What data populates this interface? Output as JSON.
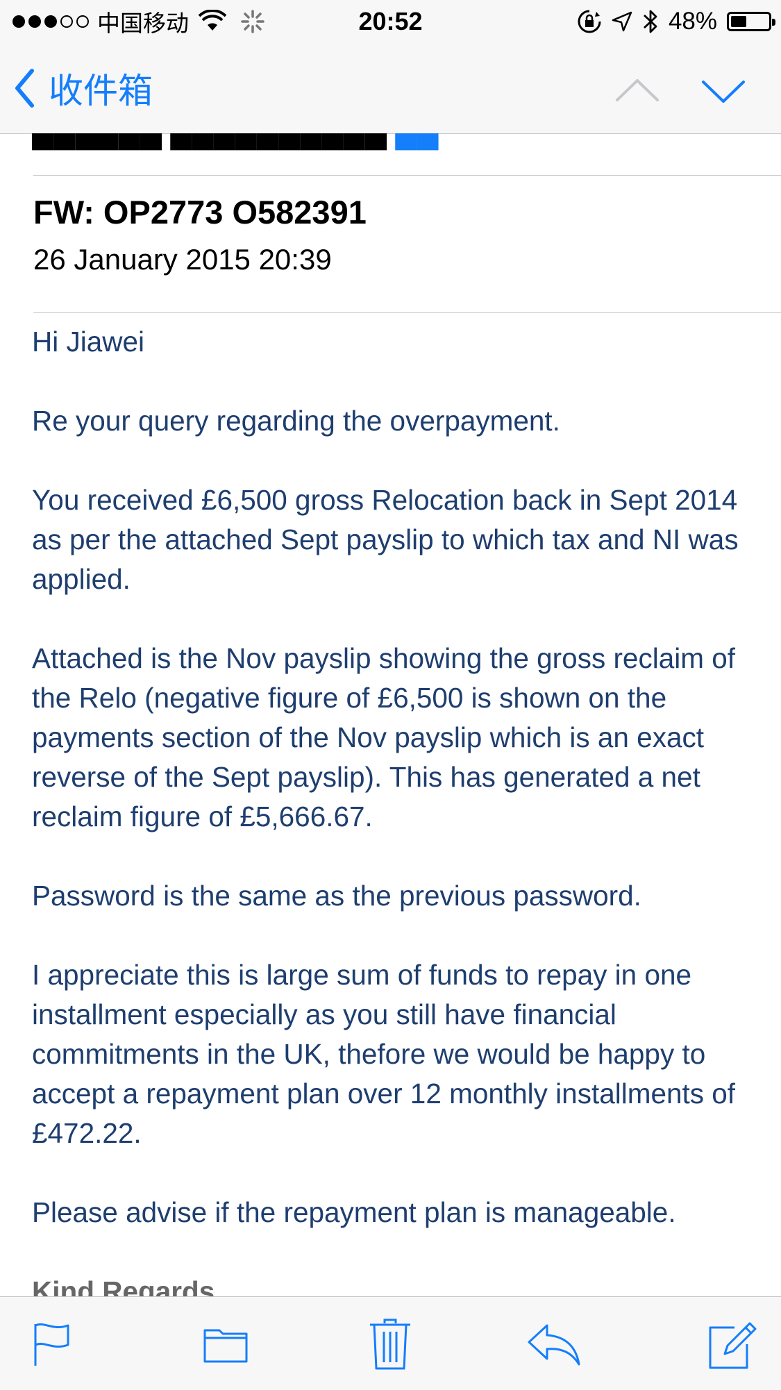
{
  "status_bar": {
    "carrier": "中国移动",
    "time": "20:52",
    "battery_percent": "48%",
    "battery_level": 0.48,
    "icons": [
      "signal-dots-icon",
      "wifi-icon",
      "activity-spinner-icon",
      "orientation-lock-icon",
      "location-arrow-icon",
      "bluetooth-icon",
      "battery-icon"
    ]
  },
  "nav": {
    "back_label": "收件箱",
    "prev_icon": "chevron-up-icon",
    "next_icon": "chevron-down-icon",
    "accent_color": "#147efb"
  },
  "email": {
    "subject": "FW: OP2773 O582391",
    "date": "26 January 2015 20:39",
    "body": [
      "Hi Jiawei",
      "Re your query regarding the overpayment.",
      "You received £6,500 gross Relocation back in Sept 2014 as per the attached Sept payslip to which tax and NI was applied.",
      "Attached is the Nov payslip showing the gross reclaim of the Relo (negative figure of £6,500 is shown on the payments section of the Nov payslip which is an exact reverse of the Sept payslip). This has generated a net reclaim figure of £5,666.67.",
      "Password is the same as the previous password.",
      "I appreciate this is large sum of funds to repay in one installment especially as you still have financial commitments in the UK, thefore we would be happy to accept a repayment plan over 12 monthly installments of £472.22.",
      "Please advise if the repayment plan is manageable."
    ],
    "sign_off": "Kind Regards",
    "body_color": "#1e3e6f"
  },
  "toolbar": {
    "icons": [
      "flag-icon",
      "folder-icon",
      "trash-icon",
      "reply-icon",
      "compose-icon"
    ]
  }
}
